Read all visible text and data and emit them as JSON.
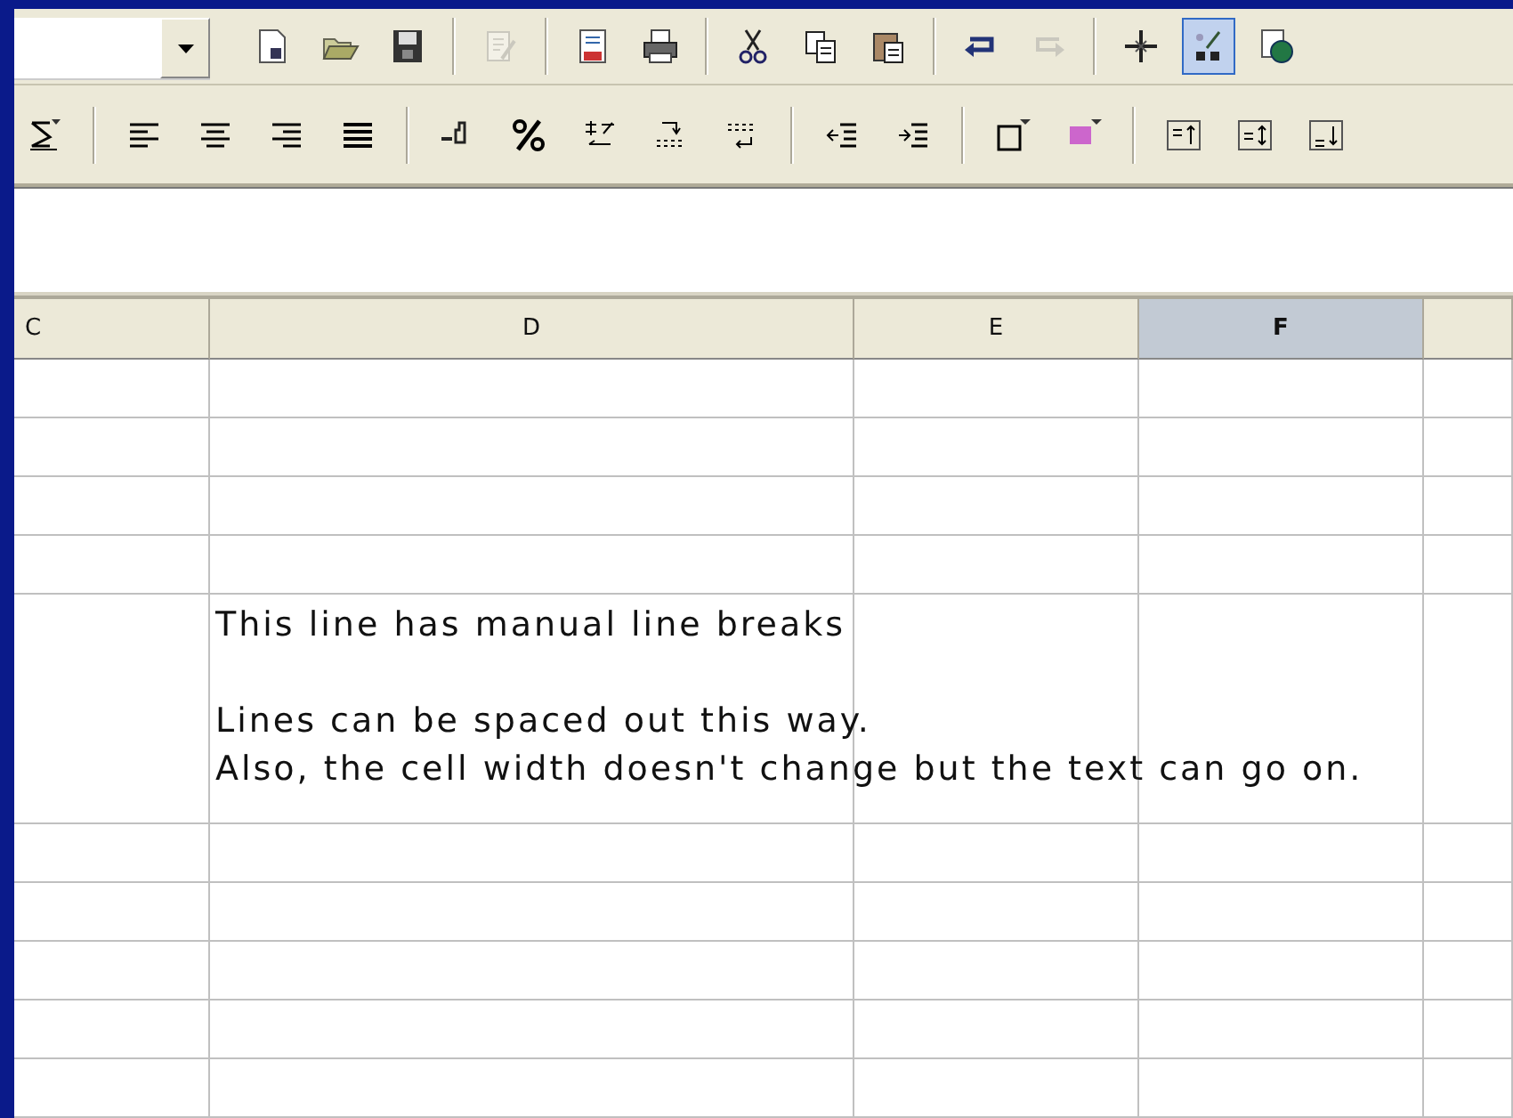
{
  "toolbars": [
    {
      "groups": [
        [
          {
            "kind": "new",
            "selected": false,
            "disabled": false
          },
          {
            "kind": "open",
            "selected": false,
            "disabled": false
          },
          {
            "kind": "save",
            "selected": false,
            "disabled": false
          }
        ],
        [
          {
            "kind": "edit",
            "selected": false,
            "disabled": true
          }
        ],
        [
          {
            "kind": "preview",
            "selected": false,
            "disabled": false
          },
          {
            "kind": "print",
            "selected": false,
            "disabled": false
          }
        ],
        [
          {
            "kind": "cut",
            "selected": false,
            "disabled": false
          },
          {
            "kind": "copy",
            "selected": false,
            "disabled": false
          },
          {
            "kind": "paste",
            "selected": false,
            "disabled": false
          }
        ],
        [
          {
            "kind": "undo",
            "selected": false,
            "disabled": false
          },
          {
            "kind": "redo",
            "selected": false,
            "disabled": true
          }
        ],
        [
          {
            "kind": "navigator",
            "selected": false,
            "disabled": false
          },
          {
            "kind": "drawing",
            "selected": true,
            "disabled": false
          },
          {
            "kind": "gallery",
            "selected": false,
            "disabled": false
          }
        ]
      ]
    },
    {
      "groups": [
        [
          {
            "kind": "fontcolor",
            "selected": false,
            "disabled": false
          }
        ],
        [
          {
            "kind": "alignleft",
            "selected": false,
            "disabled": false
          },
          {
            "kind": "aligncenter",
            "selected": false,
            "disabled": false
          },
          {
            "kind": "alignright",
            "selected": false,
            "disabled": false
          },
          {
            "kind": "justify",
            "selected": false,
            "disabled": false
          }
        ],
        [
          {
            "kind": "numberformat",
            "selected": false,
            "disabled": false
          },
          {
            "kind": "percent",
            "selected": false,
            "disabled": false
          },
          {
            "kind": "currency",
            "selected": false,
            "disabled": false
          },
          {
            "kind": "adddecimal",
            "selected": false,
            "disabled": false
          },
          {
            "kind": "deldecimal",
            "selected": false,
            "disabled": false
          }
        ],
        [
          {
            "kind": "outdent",
            "selected": false,
            "disabled": false
          },
          {
            "kind": "indent",
            "selected": false,
            "disabled": false
          }
        ],
        [
          {
            "kind": "borders",
            "selected": false,
            "disabled": false
          },
          {
            "kind": "background",
            "selected": false,
            "disabled": false
          }
        ],
        [
          {
            "kind": "valigntop",
            "selected": false,
            "disabled": false
          },
          {
            "kind": "valignmiddle",
            "selected": false,
            "disabled": false
          },
          {
            "kind": "valignbottom",
            "selected": false,
            "disabled": false
          }
        ]
      ]
    }
  ],
  "columns": [
    {
      "label": "C",
      "selected": false
    },
    {
      "label": "D",
      "selected": false
    },
    {
      "label": "E",
      "selected": false
    },
    {
      "label": "F",
      "selected": true
    }
  ],
  "text_cell": {
    "paragraphs": [
      [
        "This line has manual line breaks"
      ],
      [
        "Lines can be spaced out this way.",
        "Also, the cell width doesn't change but the text can go on."
      ]
    ]
  }
}
